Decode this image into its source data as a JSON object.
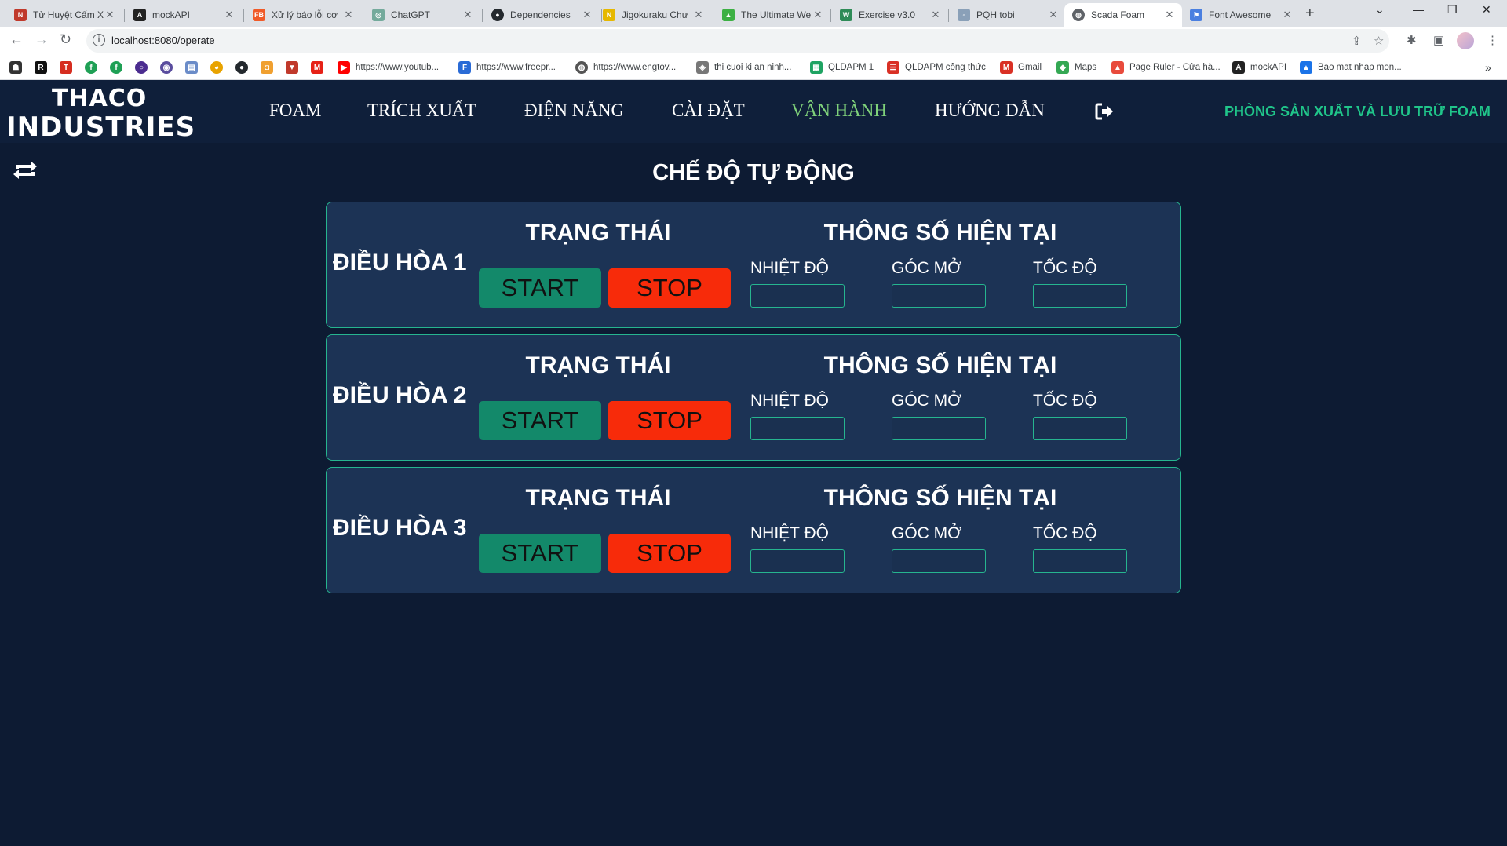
{
  "browser": {
    "tabs": [
      {
        "title": "Tử Huyệt Cấm Xâm",
        "color": "#c0392b",
        "glyph": "N"
      },
      {
        "title": "mockAPI",
        "color": "#222222",
        "glyph": "A"
      },
      {
        "title": "Xử lý báo lỗi cơ",
        "color": "#f05a28",
        "glyph": "FB"
      },
      {
        "title": "ChatGPT",
        "color": "#74aa9c",
        "glyph": "◎"
      },
      {
        "title": "Dependencies",
        "color": "#24292e",
        "glyph": "●"
      },
      {
        "title": "Jigokuraku Chư",
        "color": "#e6b800",
        "glyph": "N"
      },
      {
        "title": "The Ultimate We",
        "color": "#3cb043",
        "glyph": "▲"
      },
      {
        "title": "Exercise v3.0",
        "color": "#2e8b57",
        "glyph": "W"
      },
      {
        "title": "PQH tobi",
        "color": "#8aa0b8",
        "glyph": "◦"
      },
      {
        "title": "Scada Foam",
        "color": "#5f6368",
        "glyph": "◍"
      },
      {
        "title": "Font Awesome",
        "color": "#4a7fe0",
        "glyph": "⚑"
      }
    ],
    "url": "localhost:8080/operate",
    "bookmarks": [
      {
        "label": "https://www.youtub...",
        "color": "#ff0000",
        "glyph": "▶"
      },
      {
        "label": "https://www.freepr...",
        "color": "#2a6bd6",
        "glyph": "F"
      },
      {
        "label": "https://www.engtov...",
        "color": "#555555",
        "glyph": "◍"
      },
      {
        "label": "thi cuoi ki an ninh...",
        "color": "#777777",
        "glyph": "◈"
      },
      {
        "label": "QLDAPM 1",
        "color": "#1ea362",
        "glyph": "▦"
      },
      {
        "label": "QLDAPM công thức",
        "color": "#d93025",
        "glyph": "☰"
      },
      {
        "label": "Gmail",
        "color": "#d93025",
        "glyph": "M"
      },
      {
        "label": "Maps",
        "color": "#34a853",
        "glyph": "◆"
      },
      {
        "label": "Page Ruler - Cửa hà...",
        "color": "#e84b3c",
        "glyph": "▲"
      },
      {
        "label": "mockAPI",
        "color": "#222222",
        "glyph": "A"
      },
      {
        "label": "Bao mat nhap mon...",
        "color": "#1a73e8",
        "glyph": "▲"
      }
    ]
  },
  "brand": {
    "line1": "THACO",
    "line2": "INDUSTRIES"
  },
  "nav": {
    "items": [
      "FOAM",
      "TRÍCH XUẤT",
      "ĐIỆN NĂNG",
      "CÀI ĐẶT",
      "VẬN HÀNH",
      "HƯỚNG DẪN"
    ],
    "active_index": 4,
    "active_color": "#7fd17a",
    "logout_icon": "sign-out-icon"
  },
  "department": "PHÒNG SẢN XUẤT VÀ LƯU TRỮ FOAM",
  "page": {
    "title": "CHẾ ĐỘ TỰ ĐỘNG",
    "refresh_icon": "retweet-icon"
  },
  "units": [
    {
      "name": "ĐIỀU HÒA 1",
      "status_title": "TRẠNG THÁI",
      "start_label": "START",
      "stop_label": "STOP",
      "params_title": "THÔNG SỐ HIỆN TẠI",
      "temp_label": "NHIỆT ĐỘ",
      "temp_value": "",
      "angle_label": "GÓC MỞ",
      "angle_value": "",
      "speed_label": "TỐC ĐỘ",
      "speed_value": ""
    },
    {
      "name": "ĐIỀU HÒA 2",
      "status_title": "TRẠNG THÁI",
      "start_label": "START",
      "stop_label": "STOP",
      "params_title": "THÔNG SỐ HIỆN TẠI",
      "temp_label": "NHIỆT ĐỘ",
      "temp_value": "",
      "angle_label": "GÓC MỞ",
      "angle_value": "",
      "speed_label": "TỐC ĐỘ",
      "speed_value": ""
    },
    {
      "name": "ĐIỀU HÒA 3",
      "status_title": "TRẠNG THÁI",
      "start_label": "START",
      "stop_label": "STOP",
      "params_title": "THÔNG SỐ HIỆN TẠI",
      "temp_label": "NHIỆT ĐỘ",
      "temp_value": "",
      "angle_label": "GÓC MỞ",
      "angle_value": "",
      "speed_label": "TỐC ĐỘ",
      "speed_value": ""
    }
  ],
  "colors": {
    "background": "#0d1b33",
    "navbar": "#0f1f3a",
    "panel": "#1c3355",
    "panel_border": "#26b58f",
    "start_button": "#13896a",
    "stop_button": "#f72b0a",
    "department_text": "#20c58a"
  }
}
